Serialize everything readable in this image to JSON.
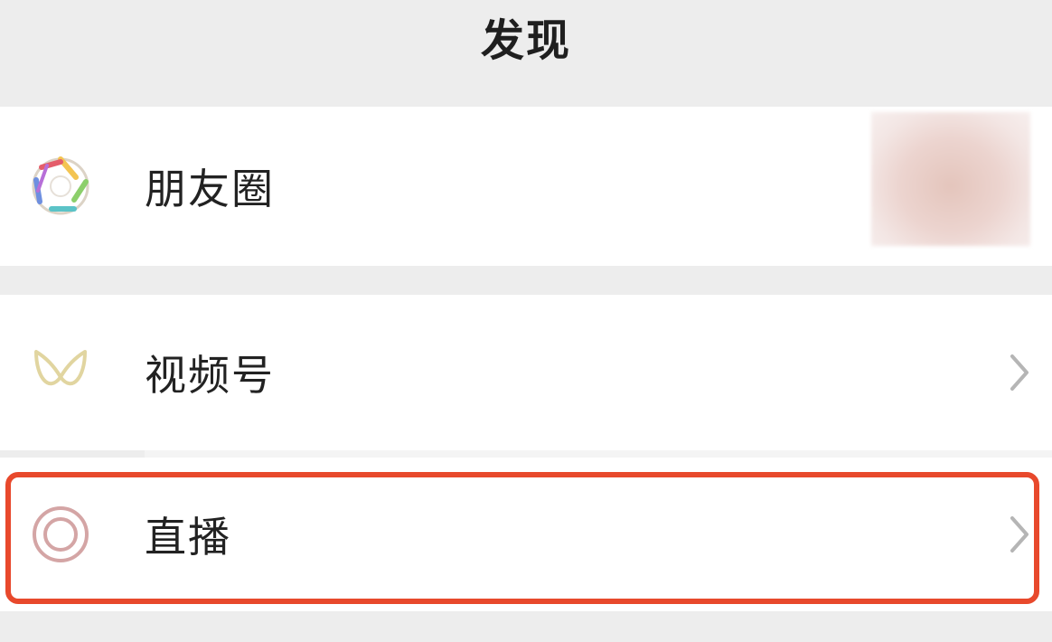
{
  "header": {
    "title": "发现"
  },
  "rows": [
    {
      "label": "朋友圈",
      "icon": "moments-aperture-icon",
      "has_thumbnail": true
    },
    {
      "label": "视频号",
      "icon": "channels-butterfly-icon",
      "has_chevron": true
    },
    {
      "label": "直播",
      "icon": "live-ring-icon",
      "has_chevron": true,
      "highlighted": true
    }
  ],
  "colors": {
    "background": "#ededed",
    "row_background": "#ffffff",
    "highlight": "#e8492c",
    "text": "#222222"
  }
}
